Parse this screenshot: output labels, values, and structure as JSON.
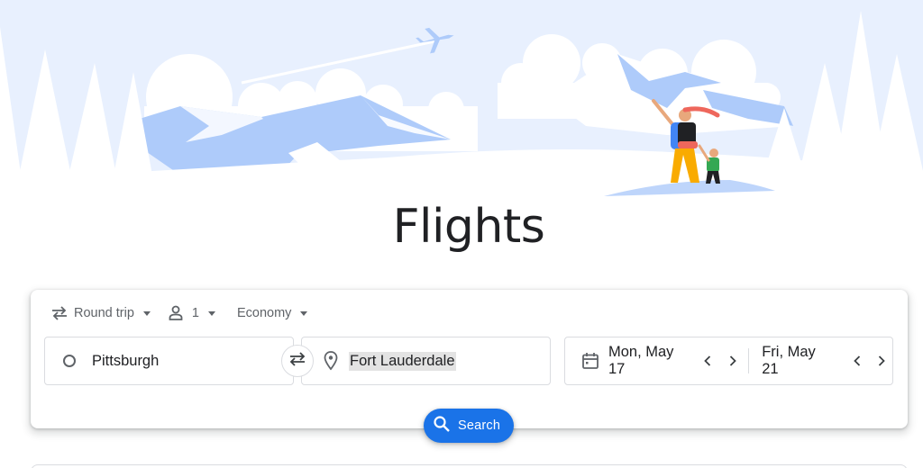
{
  "page": {
    "title": "Flights"
  },
  "options": {
    "trip_type": "Round trip",
    "passengers": "1",
    "cabin_class": "Economy"
  },
  "origin": {
    "value": "Pittsburgh"
  },
  "destination": {
    "value": "Fort Lauderdale"
  },
  "dates": {
    "departure": "Mon, May 17",
    "return": "Fri, May 21"
  },
  "search_button": {
    "label": "Search"
  },
  "colors": {
    "accent": "#1a73e8",
    "sky": "#e8f0fe",
    "mountain": "#aecbfa",
    "text": "#202124"
  },
  "icons": [
    "plane-icon",
    "swap-trip-icon",
    "person-icon",
    "origin-circle-icon",
    "swap-icon",
    "location-pin-icon",
    "calendar-icon",
    "chevron-left-icon",
    "chevron-right-icon",
    "search-icon"
  ]
}
